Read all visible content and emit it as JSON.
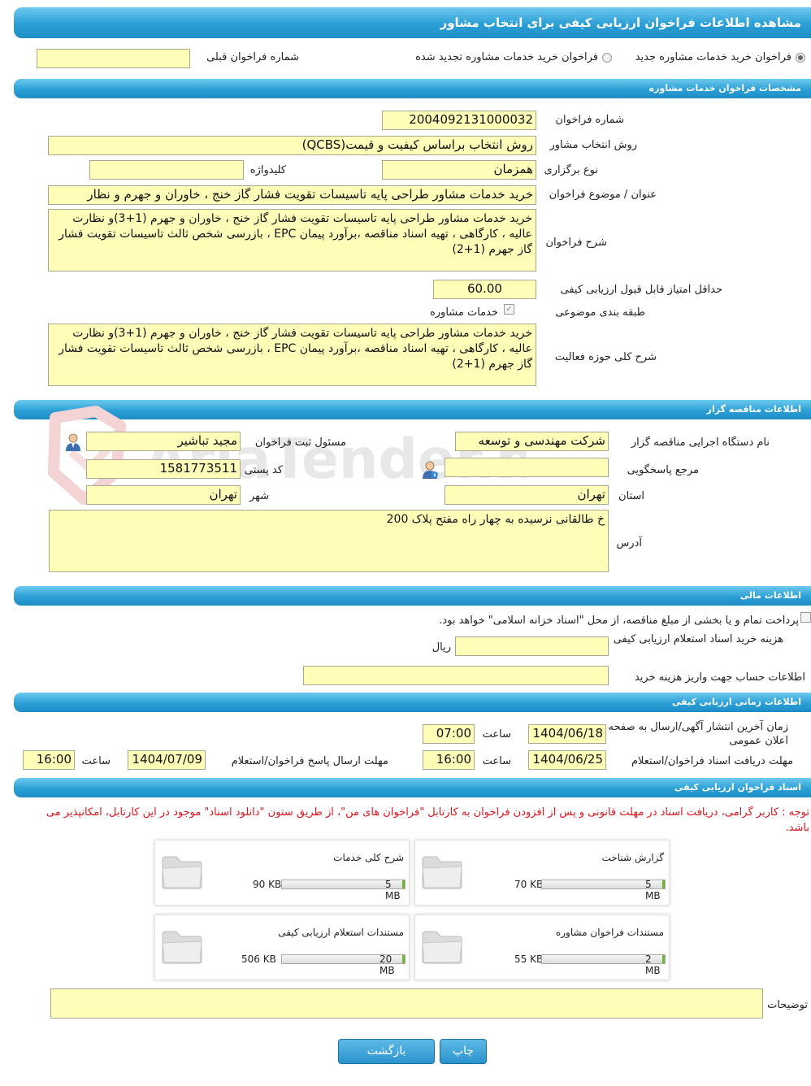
{
  "header": {
    "title": "مشاهده اطلاعات فراخوان ارزیابی کیفی برای انتخاب مشاور"
  },
  "type_selector": {
    "option_new": "فراخوان خرید خدمات مشاوره جدید",
    "option_renewed": "فراخوان خرید خدمات مشاوره تجدید شده",
    "previous_number_label": "شماره فراخوان قبلی",
    "previous_number_value": ""
  },
  "section_service": {
    "title": "مشخصات فراخوان خدمات مشاوره",
    "number_label": "شماره فراخوان",
    "number_value": "2004092131000032",
    "method_label": "روش انتخاب مشاور",
    "method_value": "روش انتخاب براساس کیفیت و قیمت(QCBS)",
    "holding_type_label": "نوع برگزاری",
    "holding_type_value": "همزمان",
    "keyword_label": "کلیدواژه",
    "keyword_value": "",
    "subject_label": "عنوان / موضوع فراخوان",
    "subject_value": "خرید خدمات مشاور طراحی پایه تاسیسات تقویت فشار گاز خنج ، خاوران و جهرم و نظار",
    "description_label": "شرح فراخوان",
    "description_value": "خرید خدمات مشاور طراحی پایه تاسیسات تقویت فشار گاز خنج ، خاوران و جهرم (1+3)و نظارت عالیه ، کارگاهی ، تهیه اسناد مناقصه ،برآورد پیمان EPC ، بازرسی شخص ثالث تاسیسات تقویت فشار گاز جهرم (1+2)",
    "min_score_label": "حداقل امتیاز قابل قبول ارزیابی کیفی",
    "min_score_value": "60.00",
    "category_label": "طبقه بندی موضوعی",
    "category_option": "خدمات مشاوره",
    "scope_label": "شرح کلی حوزه فعالیت",
    "scope_value": "خرید خدمات مشاور طراحی پایه تاسیسات تقویت فشار گاز خنج ، خاوران و جهرم (1+3)و نظارت عالیه ، کارگاهی ، تهیه اسناد مناقصه ،برآورد پیمان EPC ، بازرسی شخص ثالث تاسیسات تقویت فشار گاز جهرم (1+2)"
  },
  "section_organizer": {
    "title": "اطلاعات مناقصه گزار",
    "org_label": "نام دستگاه اجرایی مناقصه گزار",
    "org_value": "شرکت مهندسی و توسعه",
    "registrar_label": "مسئول ثبت فراخوان",
    "registrar_value": "مجید تباشیر",
    "ref_label": "مرجع پاسخگویی",
    "ref_value": "",
    "postal_label": "کد پستی",
    "postal_value": "1581773511",
    "province_label": "استان",
    "province_value": "تهران",
    "city_label": "شهر",
    "city_value": "تهران",
    "address_label": "آدرس",
    "address_value": "خ طالقانی نرسیده به چهار راه مفتح پلاک 200"
  },
  "watermark": "AriaTender.neT",
  "section_financial": {
    "title": "اطلاعات مالی",
    "treasury_text": "پرداخت تمام و یا بخشی از مبلغ مناقصه، از محل \"اسناد خزانه اسلامی\" خواهد بود.",
    "doc_cost_label": "هزینه خرید اسناد استعلام ارزیابی کیفی",
    "doc_cost_value": "",
    "currency": "ریال",
    "account_label": "اطلاعات حساب جهت واریز هزینه خرید",
    "account_value": ""
  },
  "section_time": {
    "title": "اطلاعات زمانی ارزیابی کیفی",
    "publish_label": "زمان آخرین انتشار آگهی/ارسال به صفحه اعلان عمومی",
    "publish_date": "1404/06/18",
    "time_label": "ساعت",
    "publish_time": "07:00",
    "receive_label": "مهلت دریافت اسناد فراخوان/استعلام",
    "receive_date": "1404/06/25",
    "receive_time": "16:00",
    "reply_label": "مهلت ارسال پاسخ فراخوان/استعلام",
    "reply_date": "1404/07/09",
    "reply_time": "16:00"
  },
  "section_docs": {
    "title": "اسناد فراخوان ارزیابی کیفی",
    "notice": "توجه : کاربر گرامی، دریافت اسناد در مهلت قانونی و پس از افزودن فراخوان به کارتابل \"فراخوان های من\"، از طریق ستون \"دانلود اسناد\" موجود در این کارتابل، امکانپذیر می باشد.",
    "files": [
      {
        "name": "گزارش شناخت",
        "size": "70 KB",
        "max": "5 MB"
      },
      {
        "name": "شرح کلی خدمات",
        "size": "90 KB",
        "max": "5 MB"
      },
      {
        "name": "مستندات فراخوان مشاوره",
        "size": "55 KB",
        "max": "2 MB"
      },
      {
        "name": "مستندات استعلام ارزیابی کیفی",
        "size": "506 KB",
        "max": "20 MB"
      }
    ],
    "notes_label": "توضیحات",
    "notes_value": ""
  },
  "actions": {
    "print_label": "چاپ",
    "back_label": "بازگشت"
  },
  "colors": {
    "bar": "#2b9fd6",
    "field": "#fffdb8",
    "notice": "#e0141e"
  }
}
